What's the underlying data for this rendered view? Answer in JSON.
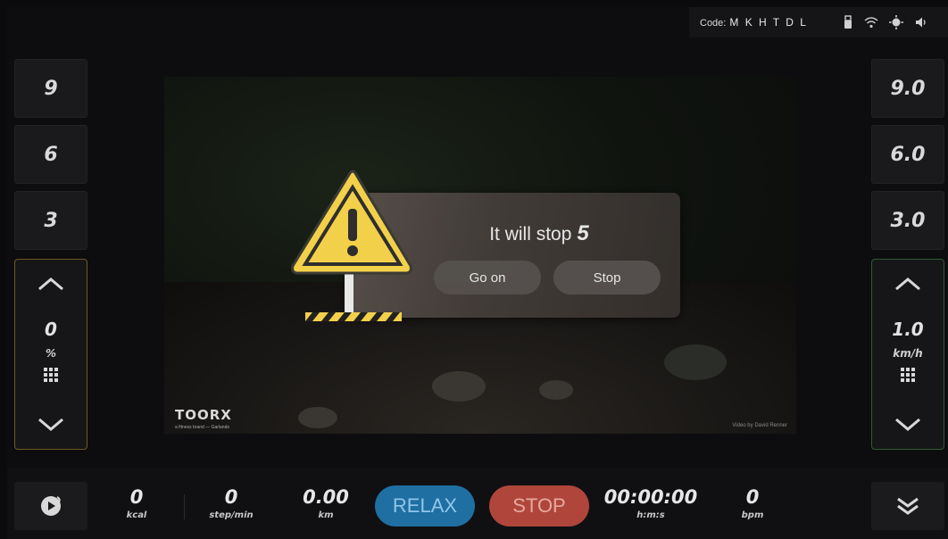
{
  "status_bar": {
    "code_label": "Code:",
    "code_value": "M K H T D L",
    "icons": [
      "usb-icon",
      "wifi-icon",
      "brightness-icon",
      "volume-icon"
    ]
  },
  "incline": {
    "presets": [
      "9",
      "6",
      "3"
    ],
    "value": "0",
    "unit": "%"
  },
  "speed": {
    "presets": [
      "9.0",
      "6.0",
      "3.0"
    ],
    "value": "1.0",
    "unit": "km/h"
  },
  "video": {
    "brand": "TOORX",
    "brand_sub": "a fitness brand — Garlando",
    "credit": "Video by David Renner"
  },
  "dialog": {
    "message": "It will stop",
    "countdown": "5",
    "go_on_label": "Go on",
    "stop_label": "Stop"
  },
  "bottom": {
    "metrics": [
      {
        "value": "0",
        "unit": "kcal"
      },
      {
        "value": "0",
        "unit": "step/min"
      },
      {
        "value": "0.00",
        "unit": "km"
      },
      {
        "value": "00:00:00",
        "unit": "h:m:s"
      },
      {
        "value": "0",
        "unit": "bpm"
      }
    ],
    "relax_label": "RELAX",
    "stop_label": "STOP"
  },
  "colors": {
    "relax": "#1f6fa3",
    "stop": "#b0463b",
    "incline_border": "#6e5a26",
    "speed_border": "#2f5a30",
    "warning_yellow": "#f2d04a"
  }
}
